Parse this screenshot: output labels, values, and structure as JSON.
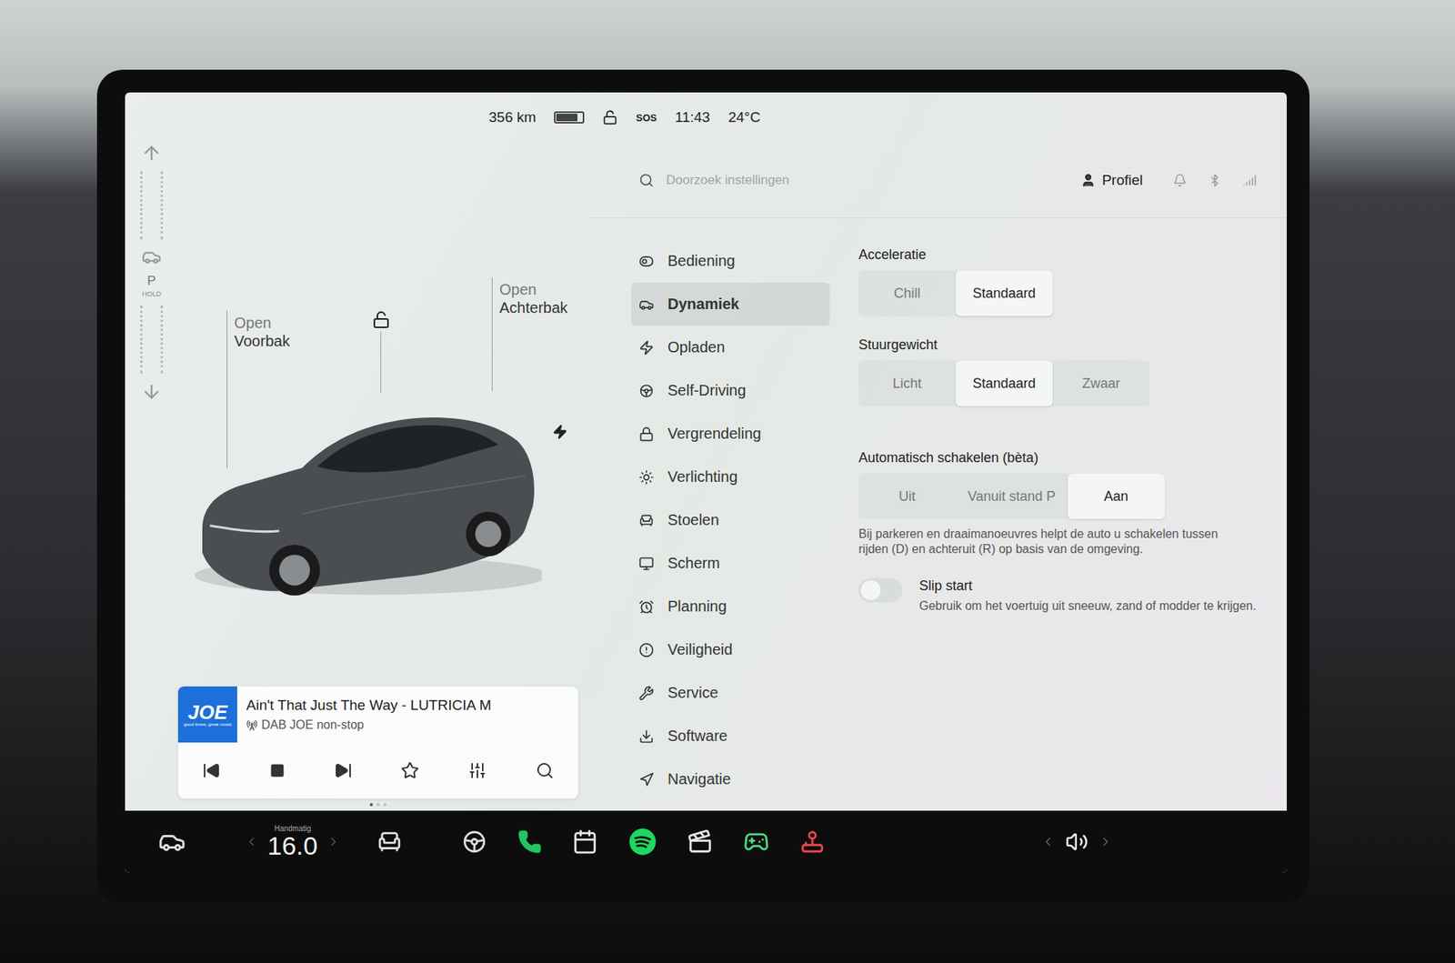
{
  "status_bar": {
    "range": "356 km",
    "battery_level": 0.8,
    "locked": false,
    "sos": "SOS",
    "time": "11:43",
    "temperature": "24°C"
  },
  "gear_selector": {
    "gear": "P",
    "hold": "HOLD"
  },
  "car_view": {
    "frunk": [
      "Open",
      "Voorbak"
    ],
    "trunk": [
      "Open",
      "Achterbak"
    ],
    "locked": false,
    "charging": true
  },
  "media": {
    "logo": "JOE",
    "slogan": "good times, great music",
    "title": "Ain't That Just The Way - LUTRICIA M",
    "source": "DAB JOE non-stop",
    "favorite": false,
    "pages": [
      {
        "selected": true
      },
      {
        "selected": false
      },
      {
        "selected": false
      }
    ]
  },
  "search": {
    "placeholder": "Doorzoek instellingen"
  },
  "profile": {
    "label": "Profiel"
  },
  "menu": [
    {
      "label": "Bediening",
      "selected": false
    },
    {
      "label": "Dynamiek",
      "selected": true
    },
    {
      "label": "Opladen",
      "selected": false
    },
    {
      "label": "Self-Driving",
      "selected": false
    },
    {
      "label": "Vergrendeling",
      "selected": false
    },
    {
      "label": "Verlichting",
      "selected": false
    },
    {
      "label": "Stoelen",
      "selected": false
    },
    {
      "label": "Scherm",
      "selected": false
    },
    {
      "label": "Planning",
      "selected": false
    },
    {
      "label": "Veiligheid",
      "selected": false
    },
    {
      "label": "Service",
      "selected": false
    },
    {
      "label": "Software",
      "selected": false
    },
    {
      "label": "Navigatie",
      "selected": false
    }
  ],
  "settings": [
    {
      "kind": "segmented",
      "title": "Acceleratie",
      "options": [
        {
          "label": "Chill",
          "selected": false
        },
        {
          "label": "Standaard",
          "selected": true
        }
      ]
    },
    {
      "kind": "segmented",
      "title": "Stuurgewicht",
      "options": [
        {
          "label": "Licht",
          "selected": false
        },
        {
          "label": "Standaard",
          "selected": true
        },
        {
          "label": "Zwaar",
          "selected": false
        }
      ]
    },
    {
      "kind": "segmented",
      "title": "Automatisch schakelen (bèta)",
      "options": [
        {
          "label": "Uit",
          "selected": false
        },
        {
          "label": "Vanuit stand P",
          "selected": false
        },
        {
          "label": "Aan",
          "selected": true
        }
      ],
      "description": "Bij parkeren en draaimanoeuvres helpt de auto u schakelen tussen rijden (D) en achteruit (R) op basis van de omgeving."
    },
    {
      "kind": "toggle",
      "title": "Slip start",
      "description": "Gebruik om het voertuig uit sneeuw, zand of modder te krijgen.",
      "on": false
    }
  ],
  "dock": {
    "climate_mode": "Handmatig",
    "temperature": "16.0",
    "apps": [
      "phone",
      "notes",
      "spotify",
      "video",
      "arcade",
      "toybox"
    ]
  }
}
